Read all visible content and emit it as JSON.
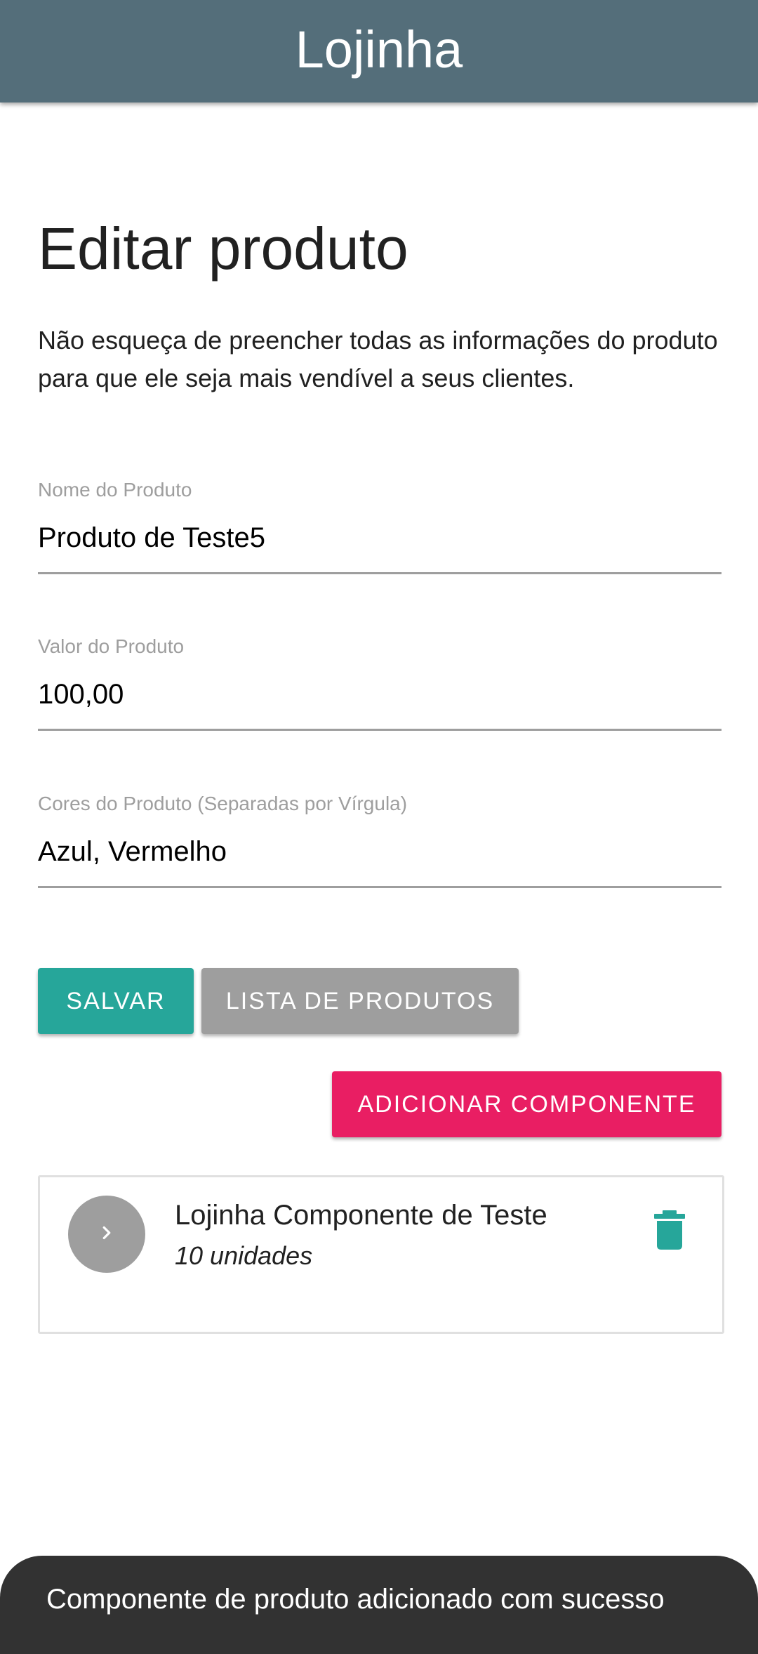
{
  "appbar": {
    "title": "Lojinha",
    "color": "#546e7a"
  },
  "page": {
    "title": "Editar produto",
    "description": "Não esqueça de preencher todas as informações do produto para que ele seja mais vendível a seus clientes."
  },
  "form": {
    "name": {
      "label": "Nome do Produto",
      "value": "Produto de Teste5"
    },
    "price": {
      "label": "Valor do Produto",
      "value": "100,00"
    },
    "colors": {
      "label": "Cores do Produto (Separadas por Vírgula)",
      "value": "Azul, Vermelho"
    }
  },
  "buttons": {
    "save_label": "SALVAR",
    "list_label": "LISTA DE PRODUTOS",
    "add_component_label": "ADICIONAR COMPONENTE",
    "save_color": "#26a69a",
    "list_color": "#9e9e9e",
    "add_component_color": "#e91e63"
  },
  "components": [
    {
      "name": "Lojinha Componente de Teste",
      "quantity": "10 unidades",
      "avatar_icon": "chevron-right-icon",
      "action_icon": "trash-icon"
    }
  ],
  "snackbar": {
    "message": "Componente de produto adicionado com sucesso"
  }
}
